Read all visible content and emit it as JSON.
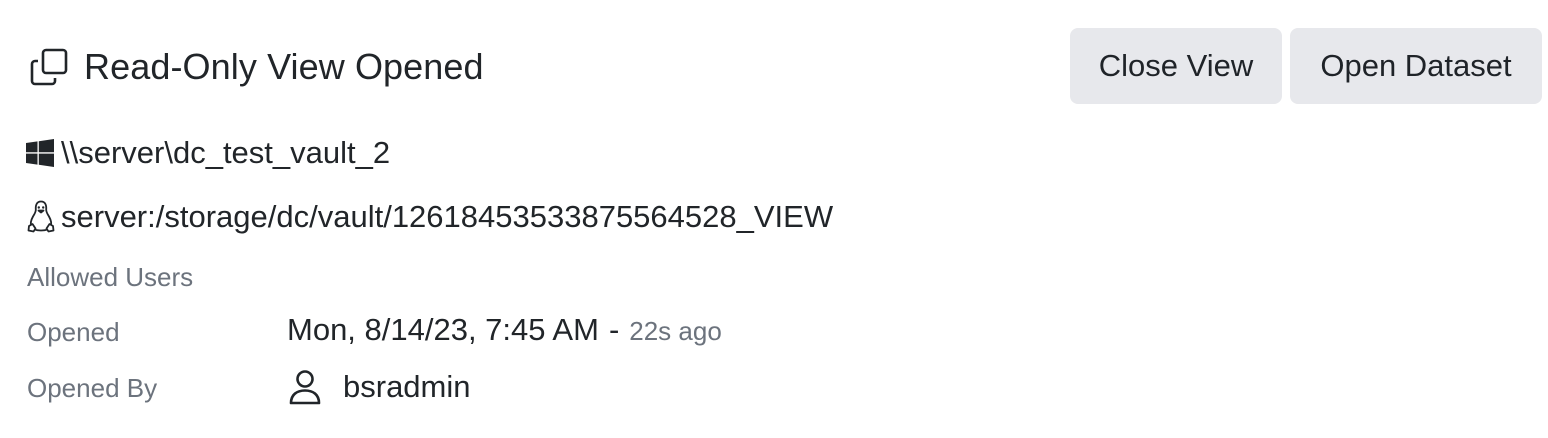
{
  "header": {
    "icon": "copy-icon",
    "title": "Read-Only View Opened"
  },
  "actions": {
    "close_label": "Close View",
    "open_label": "Open Dataset"
  },
  "paths": {
    "windows": {
      "icon": "windows-icon",
      "value": "\\\\server\\dc_test_vault_2"
    },
    "linux": {
      "icon": "linux-icon",
      "value": "server:/storage/dc/vault/1261845353387556 4528_VIEW"
    }
  },
  "details": {
    "allowed_users_label": "Allowed Users",
    "opened_label": "Opened",
    "opened_value": "Mon, 8/14/23, 7:45 AM",
    "opened_separator": "-",
    "opened_relative": "22s ago",
    "opened_by_label": "Opened By",
    "opened_by_icon": "user-icon",
    "opened_by_value": "bsradmin"
  },
  "colors": {
    "button_bg": "#e7e8ec",
    "text_primary": "#212529",
    "text_muted": "#6c737d"
  }
}
